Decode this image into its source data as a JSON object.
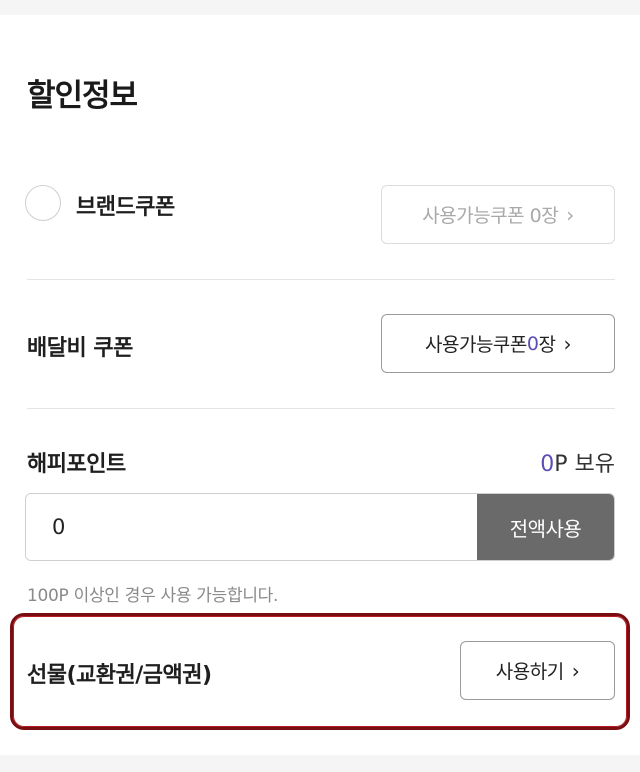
{
  "section_title": "할인정보",
  "brand_coupon": {
    "label": "브랜드쿠폰",
    "button_prefix": "사용가능쿠폰 0장",
    "chevron": "›"
  },
  "delivery_coupon": {
    "label": "배달비 쿠폰",
    "button_prefix": "사용가능쿠폰 ",
    "button_count": "0",
    "button_suffix": "장",
    "chevron": "›"
  },
  "happy_point": {
    "label": "해피포인트",
    "balance_value": "0",
    "balance_suffix": "P 보유",
    "input_value": "0",
    "use_all_label": "전액사용",
    "hint": "100P 이상인 경우 사용 가능합니다."
  },
  "gift": {
    "label": "선물(교환권/금액권)",
    "button_label": "사용하기",
    "chevron": "›"
  },
  "colors": {
    "accent": "#5b4fb4",
    "highlight_border": "#7a0d12",
    "use_all_bg": "#6a6a6a"
  }
}
